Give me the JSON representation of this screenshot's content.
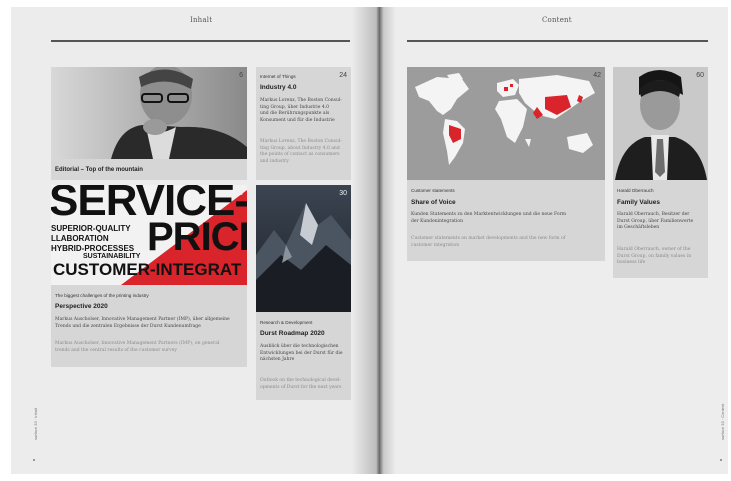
{
  "left_header": "Inhalt",
  "right_header": "Content",
  "cards": {
    "editorial": {
      "page": "6",
      "title": "Editorial – Top of the mountain"
    },
    "industry": {
      "page": "24",
      "category": "Internet of Things",
      "title": "Industry 4.0",
      "german": [
        "Markus Lorenz, The Boston Consul-",
        "ting Group, über Industrie 4.0",
        "und die Berührungspunkte als",
        "Konsument und für die Industrie"
      ],
      "english": [
        "Markus Lorenz, The Boston Consul-",
        "ting Group, about Industry 4.0 and",
        "the points of contact as consumers",
        "and industry"
      ]
    },
    "perspective": {
      "page": "10",
      "category": "The biggest challenges of the printing industry",
      "title": "Perspective 2020",
      "image_words": [
        "SERVICE-",
        "PRICE",
        "SUPERIOR-QUALITY",
        "LLABORATION",
        "HYBRID-PROCESSES",
        "SUSTAINABILITY",
        "CUSTOMER-INTEGRAT"
      ],
      "german": [
        "Markus Auscholser, Innovative Management Partner (IMP), über allgemeine",
        "Trends und die zentralen Ergebnisse der Durst Kundenumfrage"
      ],
      "english": [
        "Markus Auscholser, Innovative Management Partners (IMP), on general",
        "trends and the central results of the customer survey"
      ]
    },
    "roadmap": {
      "page": "30",
      "category": "Research & Development",
      "title": "Durst Roadmap 2020",
      "german": [
        "Ausblick über die technologischen",
        "Entwicklungen bei der Durst für die",
        "nächsten Jahre"
      ],
      "english": [
        "Outlook on the technological devel-",
        "opments of Durst for the next years"
      ]
    },
    "share": {
      "page": "42",
      "category": "Customer statements",
      "title": "Share of Voice",
      "german": [
        "Kunden Statements zu den Marktentwicklungen und die neue Form",
        "der Kundenintegration"
      ],
      "english": [
        "Customer statements on market developments and the new form of",
        "customer integration"
      ]
    },
    "family": {
      "page": "60",
      "category": "Harald Oberrauch",
      "title": "Family Values",
      "german": [
        "Harald Oberrauch, Besitzer der",
        "Durst Group, über Familienwerte",
        "im Geschäftsleben"
      ],
      "english": [
        "Harald Oberrauch, owner of the",
        "Durst Group, on family values in",
        "business life"
      ]
    }
  },
  "side_left": "surface 33 · Inhalt",
  "side_right": "surface 33 · Content",
  "colors": {
    "accent": "#d9242b",
    "panel": "#d6d6d6",
    "page": "#ececec"
  }
}
